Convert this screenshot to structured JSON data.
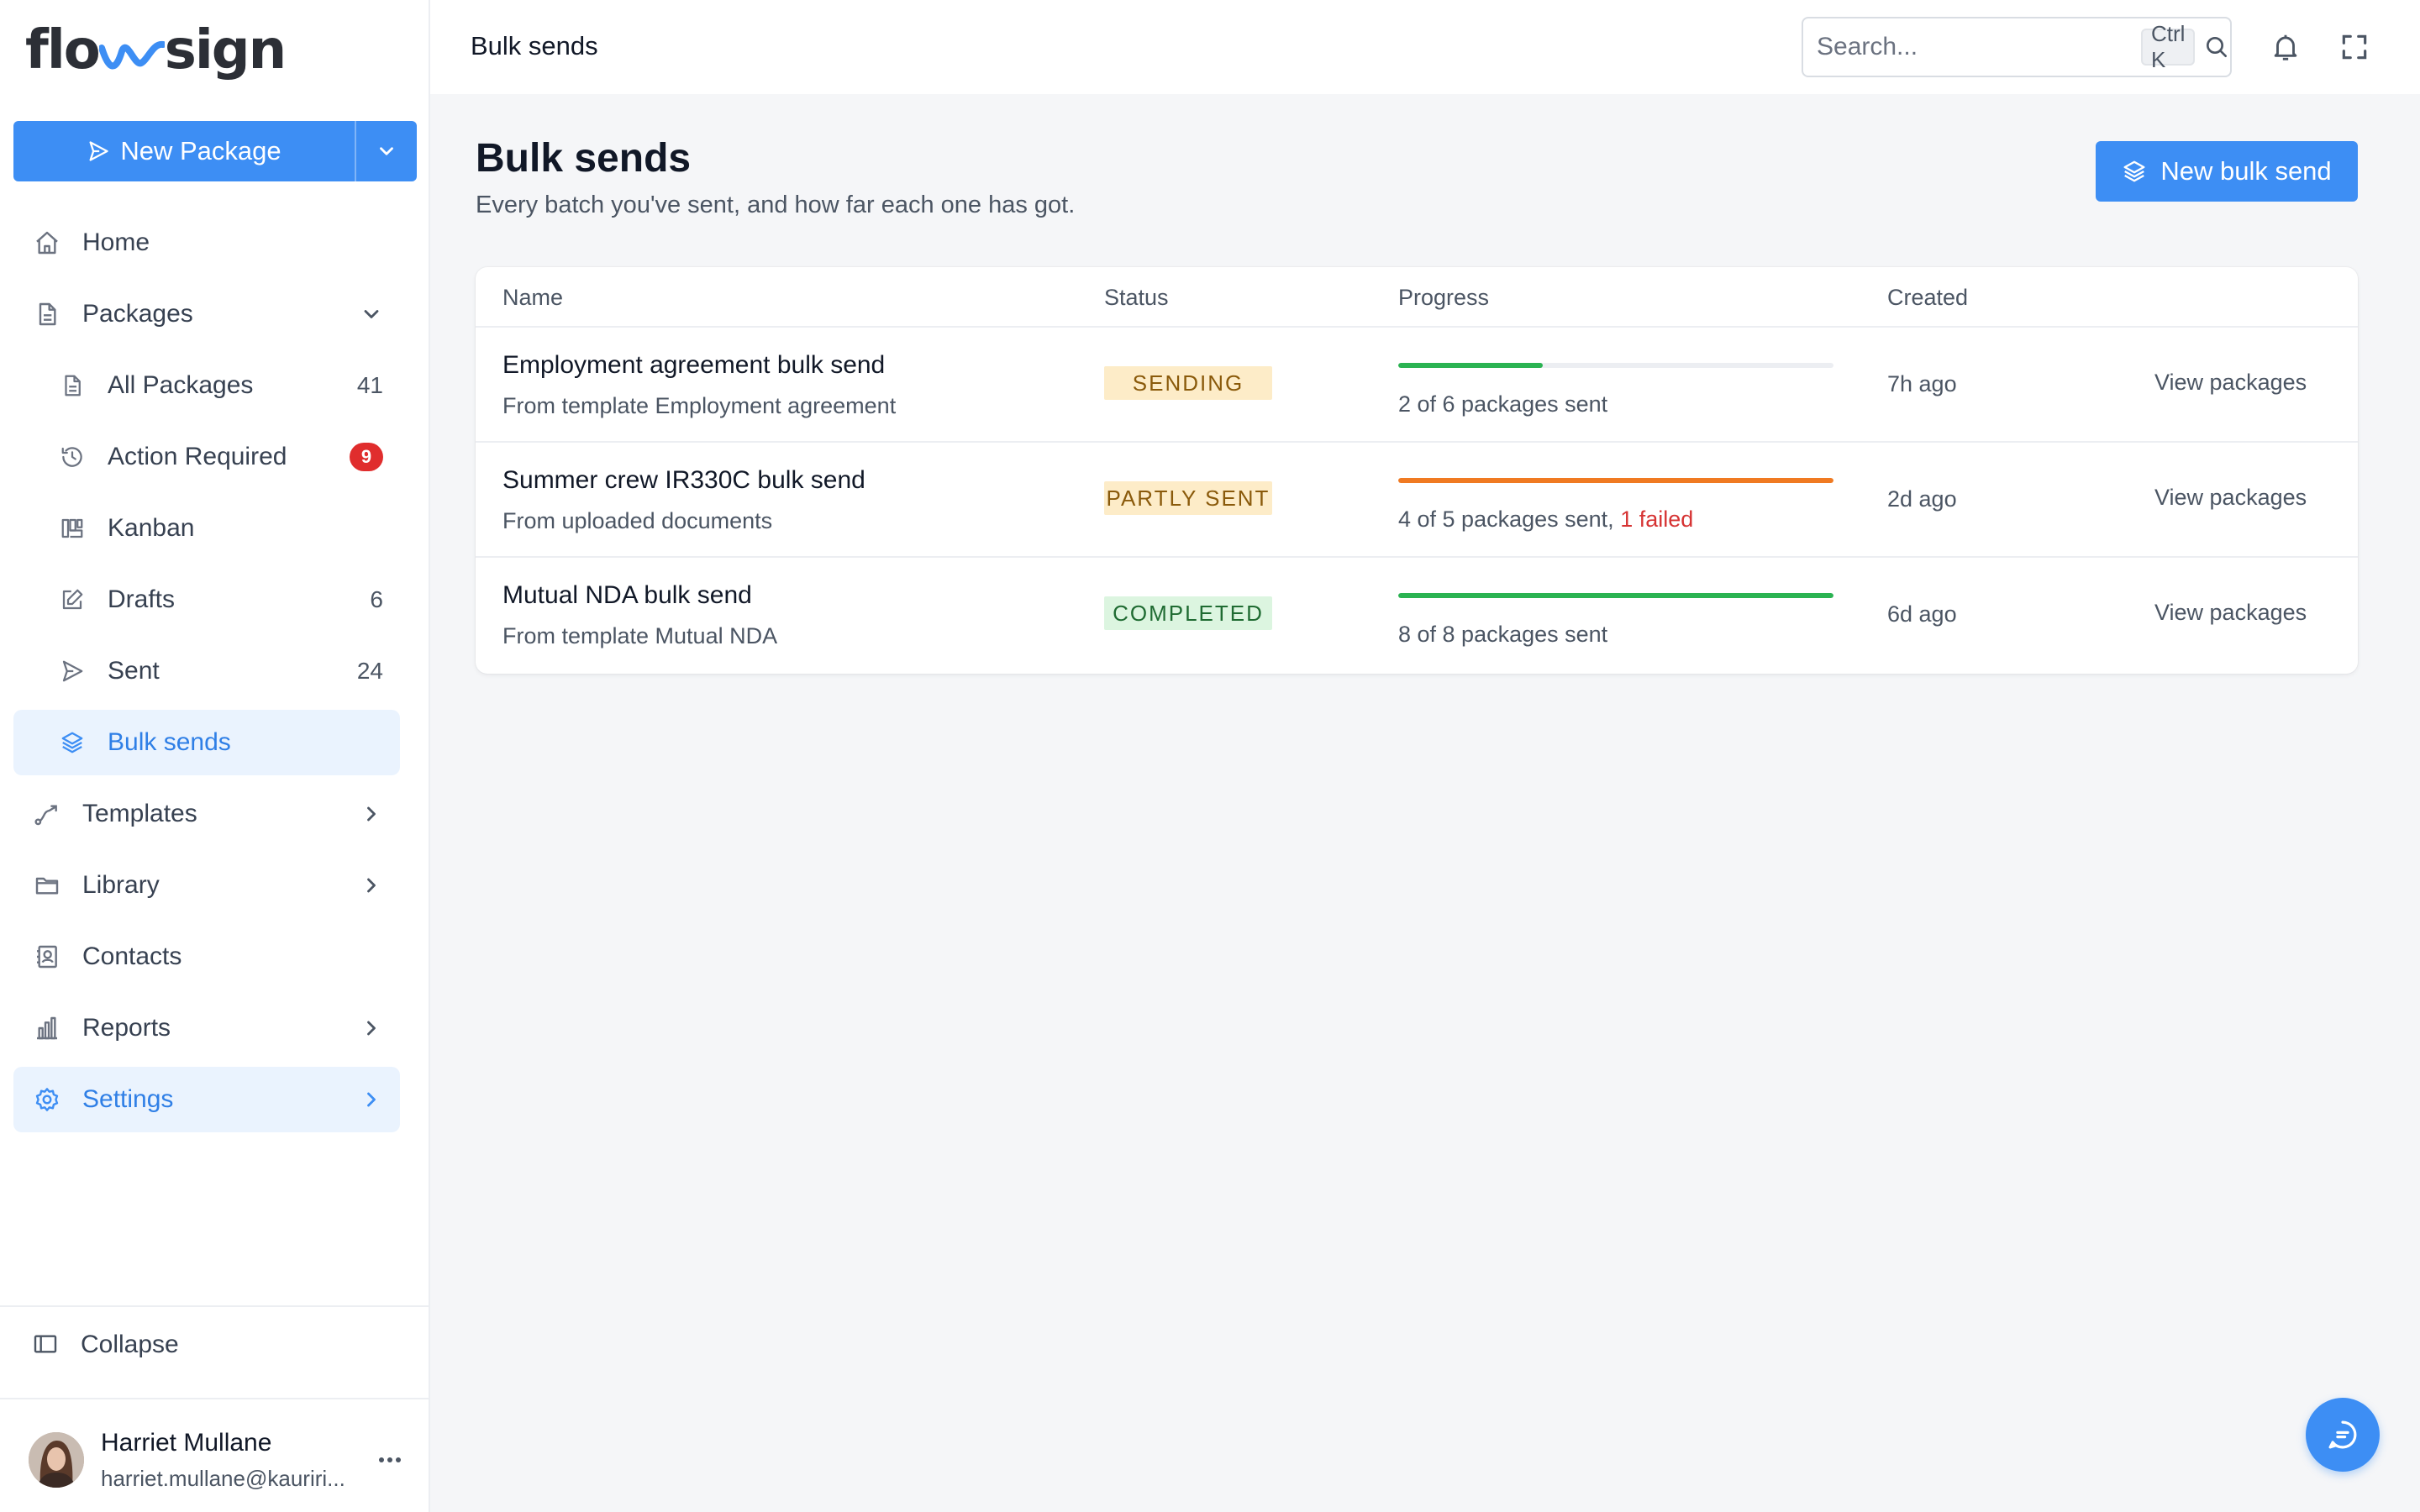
{
  "app": {
    "logo_text_a": "flo",
    "logo_text_b": "sign"
  },
  "sidebar": {
    "new_package_label": "New Package",
    "items": [
      {
        "label": "Home"
      },
      {
        "label": "Packages"
      },
      {
        "label": "All Packages",
        "count": "41"
      },
      {
        "label": "Action Required",
        "badge": "9"
      },
      {
        "label": "Kanban"
      },
      {
        "label": "Drafts",
        "count": "6"
      },
      {
        "label": "Sent",
        "count": "24"
      },
      {
        "label": "Bulk sends"
      },
      {
        "label": "Templates"
      },
      {
        "label": "Library"
      },
      {
        "label": "Contacts"
      },
      {
        "label": "Reports"
      },
      {
        "label": "Settings"
      }
    ],
    "collapse_label": "Collapse",
    "user": {
      "name": "Harriet Mullane",
      "email": "harriet.mullane@kauriri..."
    }
  },
  "header": {
    "title": "Bulk sends",
    "search_placeholder": "Search...",
    "search_shortcut": "Ctrl K"
  },
  "main": {
    "title": "Bulk sends",
    "subtitle": "Every batch you've sent, and how far each one has got.",
    "new_bulk_send_label": "New bulk send",
    "table": {
      "columns": [
        "Name",
        "Status",
        "Progress",
        "Created"
      ],
      "rows": [
        {
          "name": "Employment agreement bulk send",
          "source": "From template Employment agreement",
          "status": "SENDING",
          "progress": 0.333,
          "progress_text": "2 of 6 packages sent",
          "failed_text": "",
          "created": "7h ago",
          "action": "View packages"
        },
        {
          "name": "Summer crew IR330C bulk send",
          "source": "From uploaded documents",
          "status": "PARTLY SENT",
          "progress": 1.0,
          "progress_text": "4 of 5 packages sent, ",
          "failed_text": "1 failed",
          "created": "2d ago",
          "action": "View packages"
        },
        {
          "name": "Mutual NDA bulk send",
          "source": "From template Mutual NDA",
          "status": "COMPLETED",
          "progress": 1.0,
          "progress_text": "8 of 8 packages sent",
          "failed_text": "",
          "created": "6d ago",
          "action": "View packages"
        }
      ]
    }
  },
  "colors": {
    "accent": "#3d8ef4",
    "progress_green": "#2bb352",
    "progress_orange": "#f07a22",
    "badge_red": "#e02d2d",
    "failed_red": "#d63333"
  }
}
